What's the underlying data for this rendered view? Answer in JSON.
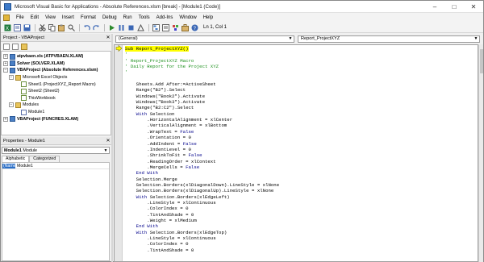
{
  "window": {
    "title": "Microsoft Visual Basic for Applications - Absolute References.xlsm [break] - [Module1 (Code)]",
    "controls": [
      "–",
      "□",
      "✕"
    ]
  },
  "menu": [
    "File",
    "Edit",
    "View",
    "Insert",
    "Format",
    "Debug",
    "Run",
    "Tools",
    "Add-Ins",
    "Window",
    "Help"
  ],
  "toolbar": {
    "status": "Ln 1, Col 1"
  },
  "project_pane": {
    "title": "Project - VBAProject",
    "close": "✕",
    "tree": [
      {
        "label": "atpvbaen.xls (ATPVBAEN.XLAM)",
        "expander": "+",
        "icon": "project"
      },
      {
        "label": "Solver (SOLVER.XLAM)",
        "expander": "+",
        "icon": "project"
      },
      {
        "label": "VBAProject (Absolute References.xlsm)",
        "expander": "−",
        "icon": "project"
      },
      {
        "label": "Microsoft Excel Objects",
        "expander": "−",
        "icon": "folder"
      },
      {
        "label": "Sheet1 (ProjectXYZ_Report Macro)",
        "expander": "",
        "icon": "sheet"
      },
      {
        "label": "Sheet2 (Sheet2)",
        "expander": "",
        "icon": "sheet"
      },
      {
        "label": "ThisWorkbook",
        "expander": "",
        "icon": "sheet"
      },
      {
        "label": "Modules",
        "expander": "−",
        "icon": "folder"
      },
      {
        "label": "Module1",
        "expander": "",
        "icon": "module"
      },
      {
        "label": "VBAProject (FUNCRES.XLAM)",
        "expander": "+",
        "icon": "project"
      }
    ]
  },
  "properties_pane": {
    "title": "Properties - Module1",
    "close": "✕",
    "object_name": "Module1",
    "object_type": "Module",
    "tabs": [
      "Alphabetic",
      "Categorized"
    ],
    "rows": [
      {
        "key": "(Name)",
        "value": "Module1"
      }
    ]
  },
  "code": {
    "object_combo": "(General)",
    "proc_combo": "Report_ProjectXYZ",
    "lines": [
      {
        "text": "Sub Report_ProjectXYZ()",
        "type": "highlight"
      },
      {
        "text": "'",
        "type": "comment"
      },
      {
        "text": "' Report_ProjectXYZ Macro",
        "type": "comment"
      },
      {
        "text": "' Daily Report for the Project XYZ",
        "type": "comment"
      },
      {
        "text": "'",
        "type": "comment"
      },
      {
        "text": "",
        "type": "code"
      },
      {
        "text": "    Sheets.Add After:=ActiveSheet",
        "type": "code"
      },
      {
        "text": "    Range(\"B2\").Select",
        "type": "code"
      },
      {
        "text": "    Windows(\"Book2\").Activate",
        "type": "code"
      },
      {
        "text": "    Windows(\"Book3\").Activate",
        "type": "code"
      },
      {
        "text": "    Range(\"B2:C2\").Select",
        "type": "code"
      },
      {
        "text": "    With Selection",
        "type": "code"
      },
      {
        "text": "        .HorizontalAlignment = xlCenter",
        "type": "code"
      },
      {
        "text": "        .VerticalAlignment = xlBottom",
        "type": "code"
      },
      {
        "text": "        .WrapText = False",
        "type": "code"
      },
      {
        "text": "        .Orientation = 0",
        "type": "code"
      },
      {
        "text": "        .AddIndent = False",
        "type": "code"
      },
      {
        "text": "        .IndentLevel = 0",
        "type": "code"
      },
      {
        "text": "        .ShrinkToFit = False",
        "type": "code"
      },
      {
        "text": "        .ReadingOrder = xlContext",
        "type": "code"
      },
      {
        "text": "        .MergeCells = False",
        "type": "code"
      },
      {
        "text": "    End With",
        "type": "code"
      },
      {
        "text": "    Selection.Merge",
        "type": "code"
      },
      {
        "text": "    Selection.Borders(xlDiagonalDown).LineStyle = xlNone",
        "type": "code"
      },
      {
        "text": "    Selection.Borders(xlDiagonalUp).LineStyle = xlNone",
        "type": "code"
      },
      {
        "text": "    With Selection.Borders(xlEdgeLeft)",
        "type": "code"
      },
      {
        "text": "        .LineStyle = xlContinuous",
        "type": "code"
      },
      {
        "text": "        .ColorIndex = 0",
        "type": "code"
      },
      {
        "text": "        .TintAndShade = 0",
        "type": "code"
      },
      {
        "text": "        .Weight = xlMedium",
        "type": "code"
      },
      {
        "text": "    End With",
        "type": "code"
      },
      {
        "text": "    With Selection.Borders(xlEdgeTop)",
        "type": "code"
      },
      {
        "text": "        .LineStyle = xlContinuous",
        "type": "code"
      },
      {
        "text": "        .ColorIndex = 0",
        "type": "code"
      },
      {
        "text": "        .TintAndShade = 0",
        "type": "code"
      }
    ]
  },
  "colors": {
    "comment": "#1a8f1a",
    "keyword": "#00008b",
    "highlight": "#ffff00",
    "selection": "#2b6fc7"
  }
}
